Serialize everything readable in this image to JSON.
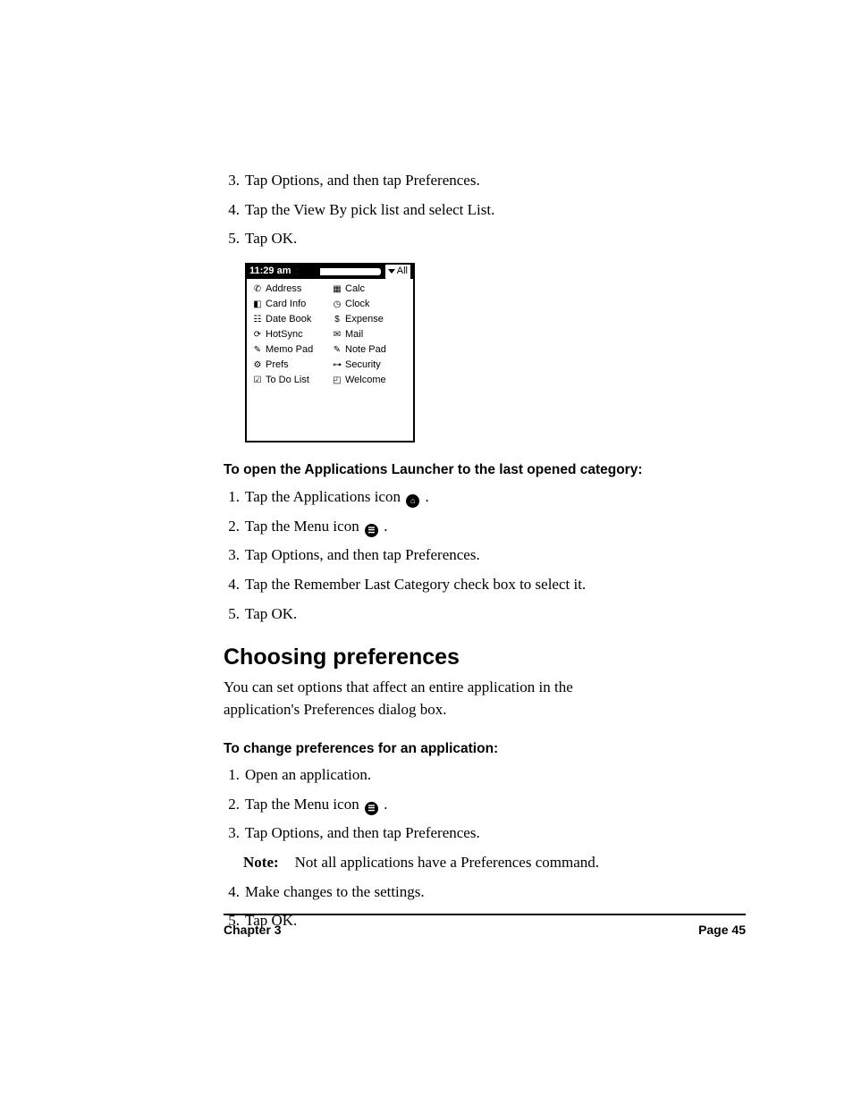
{
  "top_list": {
    "item3": {
      "num": "3.",
      "text": "Tap Options, and then tap Preferences."
    },
    "item4": {
      "num": "4.",
      "text": "Tap the View By pick list and select List."
    },
    "item5": {
      "num": "5.",
      "text": "Tap OK."
    }
  },
  "device": {
    "time": "11:29 am",
    "all_label": "All",
    "left_apps": [
      {
        "icon": "phone-icon",
        "glyph": "✆",
        "label": "Address"
      },
      {
        "icon": "card-icon",
        "glyph": "◧",
        "label": "Card Info"
      },
      {
        "icon": "datebook-icon",
        "glyph": "☷",
        "label": "Date Book"
      },
      {
        "icon": "hotsync-icon",
        "glyph": "⟳",
        "label": "HotSync"
      },
      {
        "icon": "memopad-icon",
        "glyph": "✎",
        "label": "Memo Pad"
      },
      {
        "icon": "prefs-icon",
        "glyph": "⚙",
        "label": "Prefs"
      },
      {
        "icon": "todo-icon",
        "glyph": "☑",
        "label": "To Do List"
      }
    ],
    "right_apps": [
      {
        "icon": "calc-icon",
        "glyph": "▦",
        "label": "Calc"
      },
      {
        "icon": "clock-icon",
        "glyph": "◷",
        "label": "Clock"
      },
      {
        "icon": "expense-icon",
        "glyph": "$",
        "label": "Expense"
      },
      {
        "icon": "mail-icon",
        "glyph": "✉",
        "label": "Mail"
      },
      {
        "icon": "notepad-icon",
        "glyph": "✎",
        "label": "Note Pad"
      },
      {
        "icon": "security-icon",
        "glyph": "⊶",
        "label": "Security"
      },
      {
        "icon": "welcome-icon",
        "glyph": "◰",
        "label": "Welcome"
      }
    ]
  },
  "mid_heading": "To open the Applications Launcher to the last opened category:",
  "mid_list": {
    "item1": {
      "num": "1.",
      "text_before": "Tap the Applications icon ",
      "icon": "⌂",
      "text_after": "."
    },
    "item2": {
      "num": "2.",
      "text_before": "Tap the Menu icon ",
      "icon": "☰",
      "text_after": "."
    },
    "item3": {
      "num": "3.",
      "text": "Tap Options, and then tap Preferences."
    },
    "item4": {
      "num": "4.",
      "text": "Tap the Remember Last Category check box to select it."
    },
    "item5": {
      "num": "5.",
      "text": "Tap OK."
    }
  },
  "section_title": "Choosing preferences",
  "section_para": "You can set options that affect an entire application in the application's Preferences dialog box.",
  "bot_heading": "To change preferences for an application:",
  "bot_list": {
    "item1": {
      "num": "1.",
      "text": "Open an application."
    },
    "item2": {
      "num": "2.",
      "text_before": "Tap the Menu icon ",
      "icon": "☰",
      "text_after": "."
    },
    "item3": {
      "num": "3.",
      "text": "Tap Options, and then tap Preferences."
    },
    "note": {
      "label": "Note:",
      "text": "Not all applications have a Preferences command."
    },
    "item4": {
      "num": "4.",
      "text": "Make changes to the settings."
    },
    "item5": {
      "num": "5.",
      "text": "Tap OK."
    }
  },
  "footer": {
    "left": "Chapter 3",
    "right": "Page 45"
  }
}
